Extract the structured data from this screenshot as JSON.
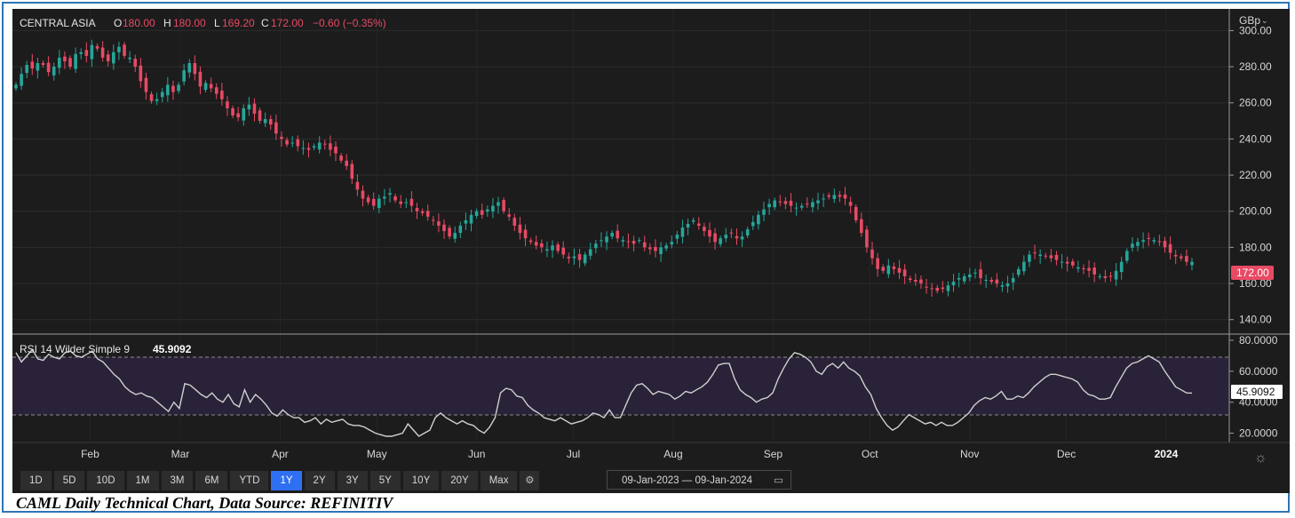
{
  "header": {
    "symbol": "CENTRAL ASIA",
    "o_label": "O",
    "o_value": "180.00",
    "h_label": "H",
    "h_value": "180.00",
    "l_label": "L",
    "l_value": "169.20",
    "c_label": "C",
    "c_value": "172.00",
    "change": "−0.60 (−0.35%)",
    "currency": "GBp"
  },
  "rsi_header": {
    "label": "RSI 14 Wilder Simple 9",
    "value": "45.9092"
  },
  "last_price_tag": "172.00",
  "rsi_value_tag": "45.9092",
  "colors": {
    "up": "#26a69a",
    "down": "#e84a64",
    "rsi_line": "#d0d0d0",
    "active_tab": "#2f6ff2"
  },
  "timeframes": [
    "1D",
    "5D",
    "10D",
    "1M",
    "3M",
    "6M",
    "YTD",
    "1Y",
    "2Y",
    "3Y",
    "5Y",
    "10Y",
    "20Y",
    "Max"
  ],
  "active_timeframe": "1Y",
  "date_range": "09-Jan-2023 — 09-Jan-2024",
  "caption": "CAML Daily Technical Chart, Data Source: REFINITIV",
  "chart_data": [
    {
      "type": "candlestick",
      "title": "CENTRAL ASIA",
      "unit": "GBp",
      "y_ticks": [
        "300.00",
        "280.00",
        "260.00",
        "240.00",
        "220.00",
        "200.00",
        "180.00",
        "160.00",
        "140.00"
      ],
      "ylim": [
        132,
        312
      ],
      "x_ticks": [
        "Feb",
        "Mar",
        "Apr",
        "May",
        "Jun",
        "Jul",
        "Aug",
        "Sep",
        "Oct",
        "Nov",
        "Dec",
        "2024"
      ],
      "x_range": [
        "2023-01-09",
        "2024-01-09"
      ],
      "closes": [
        270,
        276,
        281,
        279,
        282,
        281,
        277,
        280,
        285,
        283,
        280,
        287,
        288,
        286,
        292,
        290,
        285,
        283,
        288,
        291,
        286,
        285,
        280,
        272,
        266,
        261,
        262,
        266,
        270,
        266,
        270,
        278,
        282,
        276,
        269,
        271,
        268,
        265,
        262,
        257,
        253,
        252,
        257,
        259,
        254,
        250,
        251,
        248,
        243,
        240,
        237,
        238,
        236,
        235,
        234,
        236,
        238,
        237,
        234,
        232,
        228,
        225,
        218,
        212,
        207,
        205,
        203,
        207,
        208,
        210,
        206,
        204,
        205,
        203,
        200,
        199,
        197,
        195,
        192,
        189,
        186,
        188,
        192,
        195,
        198,
        200,
        198,
        201,
        203,
        205,
        200,
        197,
        192,
        188,
        185,
        183,
        181,
        180,
        179,
        181,
        178,
        176,
        174,
        175,
        173,
        176,
        179,
        182,
        184,
        186,
        188,
        185,
        184,
        183,
        182,
        184,
        180,
        179,
        178,
        180,
        181,
        183,
        187,
        191,
        193,
        195,
        192,
        189,
        186,
        183,
        185,
        187,
        188,
        185,
        186,
        190,
        194,
        198,
        201,
        204,
        206,
        205,
        204,
        203,
        202,
        203,
        204,
        205,
        206,
        207,
        208,
        209,
        208,
        207,
        203,
        195,
        188,
        180,
        174,
        168,
        167,
        170,
        168,
        166,
        164,
        162,
        161,
        160,
        158,
        157,
        156,
        157,
        159,
        161,
        163,
        164,
        165,
        166,
        163,
        162,
        161,
        160,
        159,
        160,
        163,
        168,
        172,
        176,
        177,
        176,
        175,
        174,
        173,
        172,
        171,
        170,
        169,
        168,
        167,
        165,
        164,
        163,
        164,
        167,
        172,
        178,
        182,
        183,
        184,
        185,
        184,
        183,
        180,
        177,
        175,
        174,
        172,
        172
      ]
    },
    {
      "type": "line",
      "title": "RSI 14 Wilder Simple 9",
      "ylim": [
        14,
        84
      ],
      "y_ticks": [
        "80.0000",
        "60.0000",
        "40.0000",
        "20.0000"
      ],
      "reference_lines": [
        70,
        30
      ],
      "last_value": 45.9092,
      "values": [
        72,
        66,
        70,
        74,
        68,
        67,
        71,
        69,
        68,
        72,
        73,
        70,
        69,
        71,
        73,
        68,
        66,
        62,
        58,
        55,
        50,
        47,
        45,
        46,
        44,
        43,
        40,
        37,
        34,
        40,
        36,
        52,
        51,
        48,
        45,
        43,
        46,
        42,
        40,
        45,
        39,
        37,
        48,
        40,
        45,
        42,
        38,
        33,
        31,
        35,
        32,
        30,
        30,
        27,
        28,
        30,
        26,
        29,
        27,
        28,
        29,
        26,
        25,
        25,
        24,
        22,
        20,
        19,
        18,
        18,
        19,
        20,
        26,
        22,
        18,
        20,
        22,
        30,
        33,
        30,
        28,
        26,
        28,
        26,
        25,
        22,
        20,
        24,
        30,
        46,
        49,
        48,
        44,
        43,
        38,
        35,
        33,
        30,
        29,
        28,
        30,
        28,
        26,
        27,
        28,
        30,
        33,
        32,
        30,
        35,
        30,
        30,
        38,
        46,
        51,
        52,
        49,
        45,
        47,
        46,
        45,
        42,
        44,
        47,
        46,
        48,
        50,
        53,
        58,
        64,
        65,
        65,
        55,
        48,
        45,
        43,
        40,
        42,
        43,
        46,
        55,
        62,
        68,
        72,
        71,
        69,
        66,
        60,
        58,
        63,
        65,
        62,
        66,
        62,
        60,
        57,
        50,
        45,
        36,
        30,
        25,
        22,
        24,
        28,
        32,
        30,
        28,
        26,
        27,
        25,
        27,
        25,
        25,
        27,
        30,
        33,
        38,
        41,
        43,
        42,
        44,
        47,
        42,
        42,
        44,
        43,
        46,
        50,
        53,
        56,
        58,
        58,
        57,
        56,
        55,
        53,
        48,
        45,
        44,
        42,
        42,
        43,
        50,
        56,
        62,
        65,
        66,
        68,
        70,
        68,
        66,
        60,
        55,
        50,
        48,
        46,
        45.9
      ]
    }
  ]
}
